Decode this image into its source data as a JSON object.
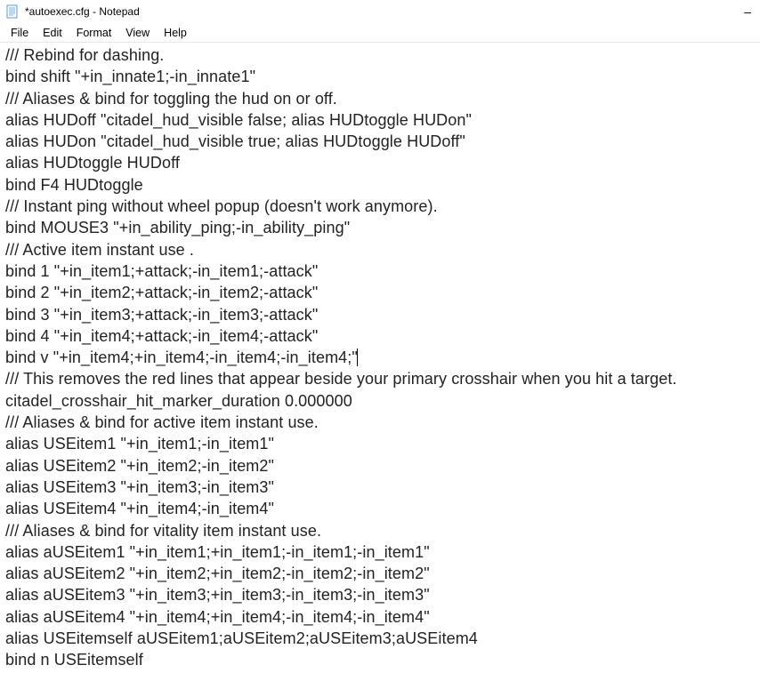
{
  "window": {
    "title": "*autoexec.cfg - Notepad",
    "minimize_dash": "–"
  },
  "menu": {
    "file": "File",
    "edit": "Edit",
    "format": "Format",
    "view": "View",
    "help": "Help"
  },
  "content": {
    "lines": [
      "/// Rebind for dashing.",
      "bind shift \"+in_innate1;-in_innate1\"",
      "/// Aliases & bind for toggling the hud on or off.",
      "alias HUDoff \"citadel_hud_visible false; alias HUDtoggle HUDon\"",
      "alias HUDon \"citadel_hud_visible true; alias HUDtoggle HUDoff\"",
      "alias HUDtoggle HUDoff",
      "bind F4 HUDtoggle",
      "/// Instant ping without wheel popup (doesn't work anymore).",
      "bind MOUSE3 \"+in_ability_ping;-in_ability_ping\"",
      "/// Active item instant use .",
      "bind 1 \"+in_item1;+attack;-in_item1;-attack\"",
      "bind 2 \"+in_item2;+attack;-in_item2;-attack\"",
      "bind 3 \"+in_item3;+attack;-in_item3;-attack\"",
      "bind 4 \"+in_item4;+attack;-in_item4;-attack\"",
      "bind v \"+in_item4;+in_item4;-in_item4;-in_item4;\"",
      "/// This removes the red lines that appear beside your primary crosshair when you hit a target.",
      "citadel_crosshair_hit_marker_duration 0.000000",
      "/// Aliases & bind for active item instant use.",
      "alias USEitem1 \"+in_item1;-in_item1\"",
      "alias USEitem2 \"+in_item2;-in_item2\"",
      "alias USEitem3 \"+in_item3;-in_item3\"",
      "alias USEitem4 \"+in_item4;-in_item4\"",
      "/// Aliases & bind for vitality item instant use.",
      "alias aUSEitem1 \"+in_item1;+in_item1;-in_item1;-in_item1\"",
      "alias aUSEitem2 \"+in_item2;+in_item2;-in_item2;-in_item2\"",
      "alias aUSEitem3 \"+in_item3;+in_item3;-in_item3;-in_item3\"",
      "alias aUSEitem4 \"+in_item4;+in_item4;-in_item4;-in_item4\"",
      "alias USEitemself aUSEitem1;aUSEitem2;aUSEitem3;aUSEitem4",
      "bind n USEitemself"
    ],
    "cursor_line_index": 14
  }
}
